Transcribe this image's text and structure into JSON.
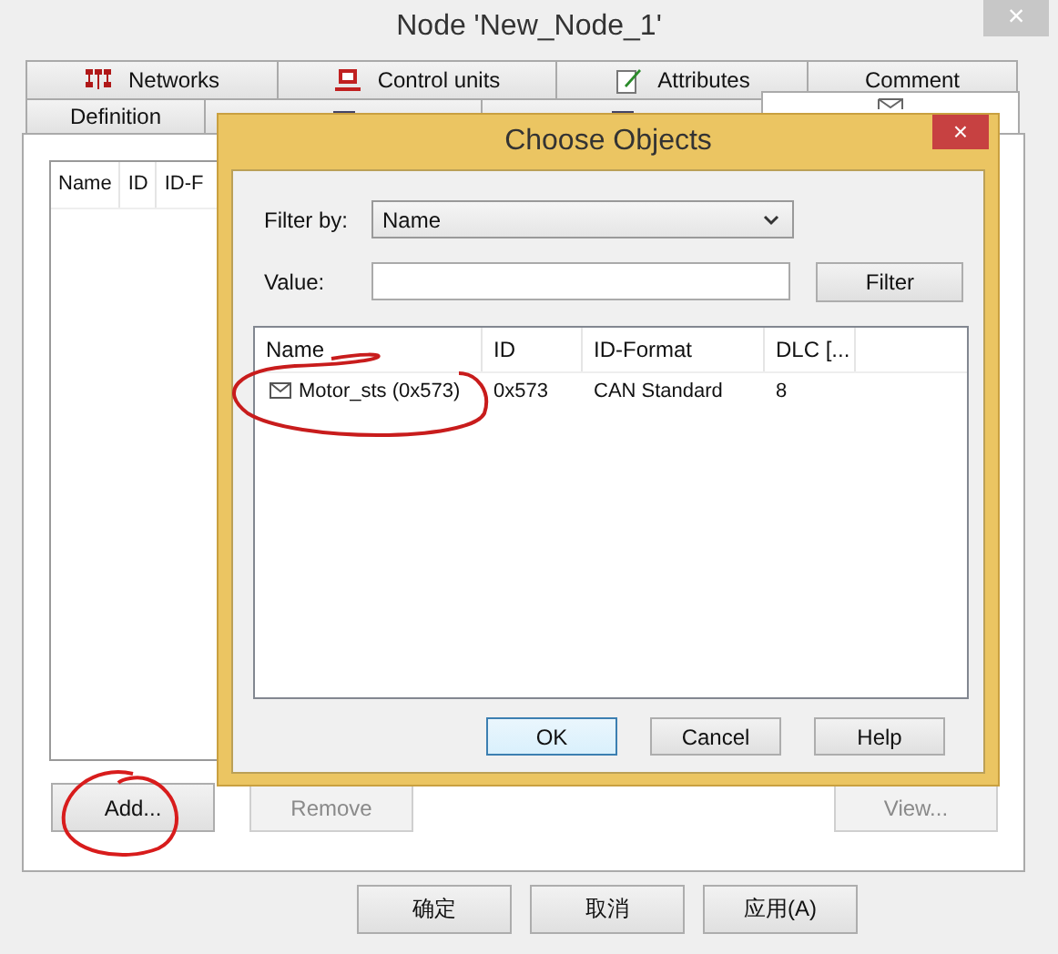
{
  "window": {
    "title": "Node 'New_Node_1'",
    "close": "×"
  },
  "tab_rows": [
    [
      {
        "label": "Networks",
        "selected": false
      },
      {
        "label": "Control units",
        "selected": false
      },
      {
        "label": "Attributes",
        "selected": false
      },
      {
        "label": "Comment",
        "selected": false
      }
    ],
    [
      {
        "label": "Definition",
        "selected": false
      },
      {
        "selected": false
      },
      {
        "selected": false
      },
      {
        "selected": true
      }
    ]
  ],
  "list": {
    "columns": [
      "Name",
      "ID",
      "ID-F"
    ]
  },
  "panel_buttons": [
    {
      "label": "Add...",
      "disabled": false,
      "highlighted": true
    },
    {
      "label": "Remove",
      "disabled": true,
      "highlighted": false
    },
    {
      "label": "View...",
      "disabled": true,
      "highlighted": false
    }
  ],
  "footer_buttons": [
    "确定",
    "取消",
    "应用(A)"
  ],
  "dialog": {
    "title": "Choose Objects",
    "close": "×",
    "filter_by": {
      "label": "Filter by:",
      "value": "Name"
    },
    "value": {
      "label": "Value:"
    },
    "filter_button": "Filter",
    "table": {
      "columns": [
        "Name",
        "ID",
        "ID-Format",
        "DLC [..."
      ],
      "rows": [
        {
          "name": "Motor_sts (0x573)",
          "id": "0x573",
          "format": "CAN Standard",
          "dlc": "8",
          "highlighted": true
        }
      ]
    },
    "buttons": [
      {
        "label": "OK",
        "default": true
      },
      {
        "label": "Cancel",
        "default": false
      },
      {
        "label": "Help",
        "default": false
      }
    ]
  }
}
